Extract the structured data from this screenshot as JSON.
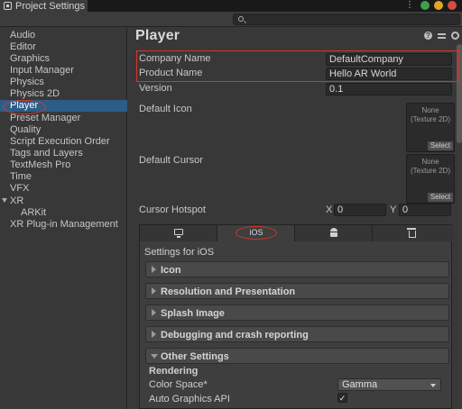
{
  "window": {
    "title": "Project Settings",
    "dot_colors": [
      "#3aa34a",
      "#e0a52a",
      "#d64c3f"
    ]
  },
  "search": {
    "placeholder": "",
    "value": ""
  },
  "sidebar": {
    "items": [
      {
        "label": "Audio"
      },
      {
        "label": "Editor"
      },
      {
        "label": "Graphics"
      },
      {
        "label": "Input Manager"
      },
      {
        "label": "Physics"
      },
      {
        "label": "Physics 2D"
      },
      {
        "label": "Player"
      },
      {
        "label": "Preset Manager"
      },
      {
        "label": "Quality"
      },
      {
        "label": "Script Execution Order"
      },
      {
        "label": "Tags and Layers"
      },
      {
        "label": "TextMesh Pro"
      },
      {
        "label": "Time"
      },
      {
        "label": "VFX"
      },
      {
        "label": "XR"
      },
      {
        "label": "ARKit"
      },
      {
        "label": "XR Plug-in Management"
      }
    ],
    "selected": "Player"
  },
  "main": {
    "title": "Player",
    "company_name_label": "Company Name",
    "company_name_value": "DefaultCompany",
    "product_name_label": "Product Name",
    "product_name_value": "Hello AR World",
    "version_label": "Version",
    "version_value": "0.1",
    "default_icon_label": "Default Icon",
    "default_cursor_label": "Default Cursor",
    "texture_none_line1": "None",
    "texture_none_line2": "(Texture 2D)",
    "texture_select": "Select",
    "cursor_hotspot_label": "Cursor Hotspot",
    "hotspot_x_label": "X",
    "hotspot_x_value": "0",
    "hotspot_y_label": "Y",
    "hotspot_y_value": "0"
  },
  "platform_tabs": {
    "items": [
      {
        "icon": "monitor-icon",
        "label": ""
      },
      {
        "icon": "",
        "label": "iOS"
      },
      {
        "icon": "android-icon",
        "label": ""
      },
      {
        "icon": "trash-icon",
        "label": ""
      }
    ],
    "active": "iOS"
  },
  "ios_settings": {
    "heading": "Settings for iOS",
    "sections": [
      {
        "label": "Icon",
        "expanded": false
      },
      {
        "label": "Resolution and Presentation",
        "expanded": false
      },
      {
        "label": "Splash Image",
        "expanded": false
      },
      {
        "label": "Debugging and crash reporting",
        "expanded": false
      },
      {
        "label": "Other Settings",
        "expanded": true
      }
    ],
    "rendering_label": "Rendering",
    "color_space_label": "Color Space*",
    "color_space_value": "Gamma",
    "auto_graphics_label": "Auto Graphics API",
    "auto_graphics_checked": true,
    "check_glyph": "✓"
  },
  "highlight_color": "#d9342b"
}
